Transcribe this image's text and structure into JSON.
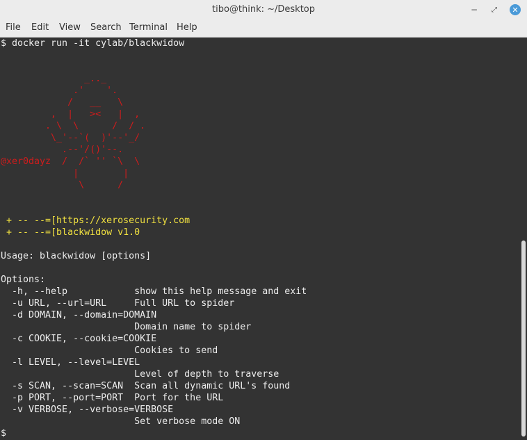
{
  "window": {
    "title": "tibo@think: ~/Desktop",
    "minimize_glyph": "−",
    "maximize_glyph": "⤢",
    "close_glyph": "✕"
  },
  "menu": {
    "items": [
      "File",
      "Edit",
      "View",
      "Search",
      "Terminal",
      "Help"
    ]
  },
  "terminal": {
    "command": "$ docker run -it cylab/blackwidow",
    "ascii_art": "               _.._\n             .'    '.\n            /   __   \\\n         ,  |   ><   |  ,\n        . \\  \\      /  / .\n         \\_'--`(  )'--'_/\n           .--'/()'--.",
    "ascii_handle_line": "@xer0dayz  /  /` '' `\\  \\",
    "ascii_tail": "             |        |\n              \\      /",
    "banner_lines": [
      " + -- --=[https://xerosecurity.com",
      " + -- --=[blackwidow v1.0"
    ],
    "usage": "Usage: blackwidow [options]",
    "options_header": "Options:",
    "options_lines": [
      "  -h, --help            show this help message and exit",
      "  -u URL, --url=URL     Full URL to spider",
      "  -d DOMAIN, --domain=DOMAIN",
      "                        Domain name to spider",
      "  -c COOKIE, --cookie=COOKIE",
      "                        Cookies to send",
      "  -l LEVEL, --level=LEVEL",
      "                        Level of depth to traverse",
      "  -s SCAN, --scan=SCAN  Scan all dynamic URL's found",
      "  -p PORT, --port=PORT  Port for the URL",
      "  -v VERBOSE, --verbose=VERBOSE",
      "                        Set verbose mode ON"
    ],
    "prompt": "$"
  },
  "colors": {
    "terminal_bg": "#333333",
    "text": "#ececec",
    "art_red": "#d01c1c",
    "banner_yellow": "#f0e040",
    "close_button": "#4a9ad8"
  }
}
